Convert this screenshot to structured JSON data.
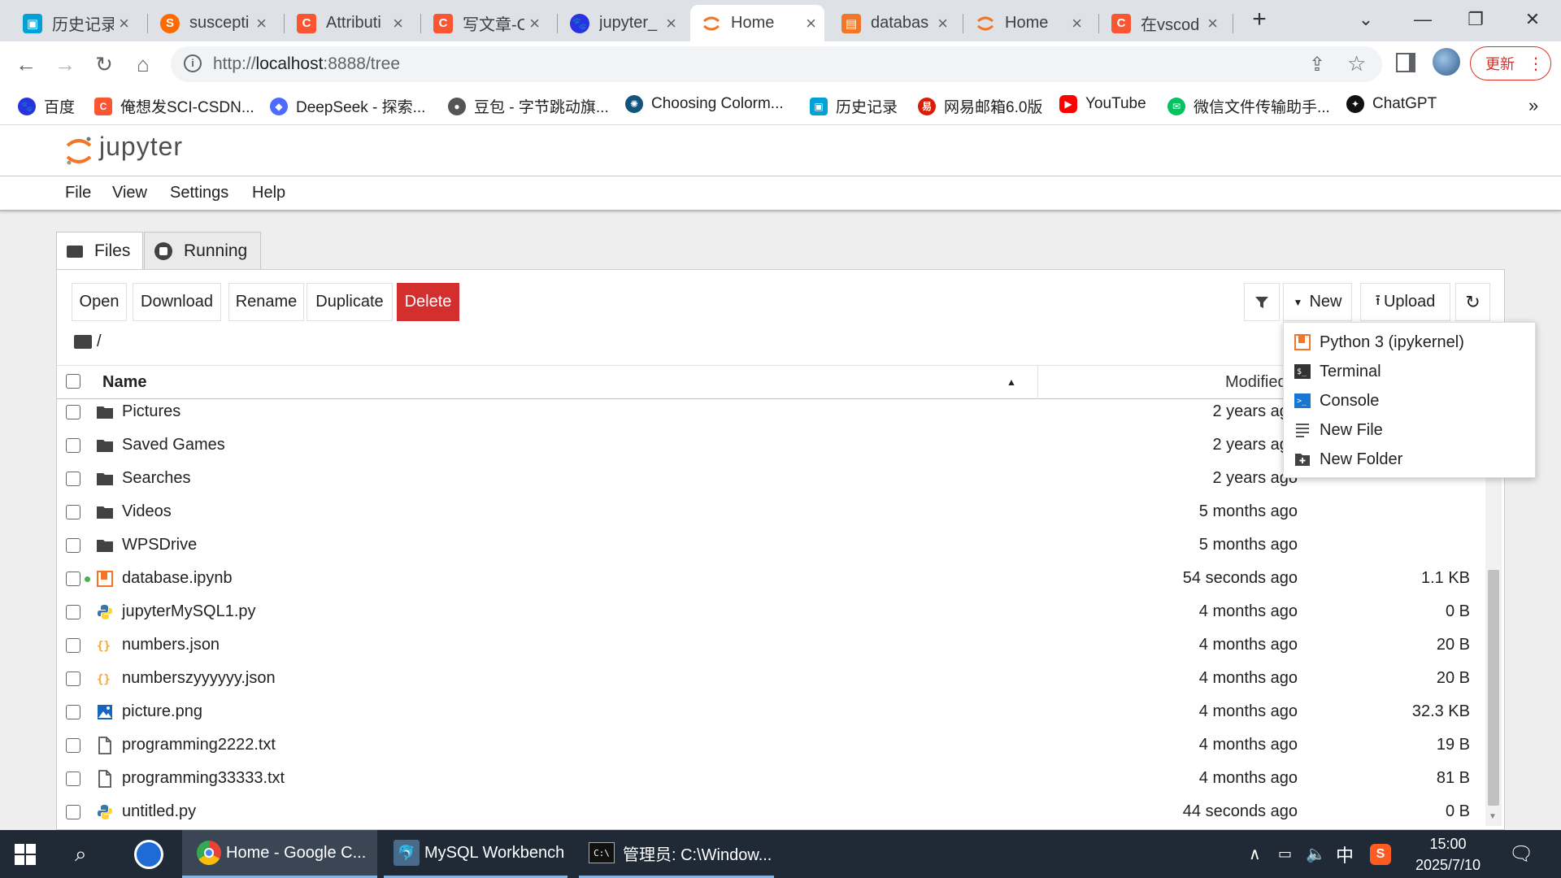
{
  "browser": {
    "tabs": [
      {
        "title": "历史记录",
        "icon": "bilibili-icon",
        "color": "#00a1d6"
      },
      {
        "title": "suscepti",
        "icon": "sougou-icon",
        "color": "#ff6a00"
      },
      {
        "title": "Attributi",
        "icon": "csdn-icon",
        "color": "#fc5531"
      },
      {
        "title": "写文章-C",
        "icon": "csdn-icon",
        "color": "#fc5531"
      },
      {
        "title": "jupyter_",
        "icon": "baidu-paw-icon",
        "color": "#2932e1"
      },
      {
        "title": "Home",
        "icon": "jupyter-icon",
        "color": "#f37626"
      },
      {
        "title": "databas",
        "icon": "notebook-icon",
        "color": "#f37626"
      },
      {
        "title": "Home",
        "icon": "jupyter-icon",
        "color": "#f37626"
      },
      {
        "title": "在vscod",
        "icon": "csdn-icon",
        "color": "#fc5531"
      }
    ],
    "active_tab": 5,
    "url_scheme": "http://",
    "url_host": "localhost",
    "url_rest": ":8888/tree",
    "update_label": "更新",
    "bookmarks": [
      {
        "label": "百度",
        "icon": "baidu-paw-icon",
        "color": "#2932e1"
      },
      {
        "label": "俺想发SCI-CSDN...",
        "icon": "csdn-icon",
        "color": "#fc5531"
      },
      {
        "label": "DeepSeek - 探索...",
        "icon": "deepseek-icon",
        "color": "#4d6bfe"
      },
      {
        "label": "豆包 - 字节跳动旗...",
        "icon": "doubao-icon",
        "color": "#666666"
      },
      {
        "label": "Choosing Colorm...",
        "icon": "matplotlib-icon",
        "color": "#11557c"
      },
      {
        "label": "历史记录",
        "icon": "bilibili-icon",
        "color": "#00a1d6"
      },
      {
        "label": "网易邮箱6.0版",
        "icon": "netease-icon",
        "color": "#d81e06"
      },
      {
        "label": "YouTube",
        "icon": "youtube-icon",
        "color": "#ff0000"
      },
      {
        "label": "微信文件传输助手...",
        "icon": "wechat-icon",
        "color": "#07c160"
      },
      {
        "label": "ChatGPT",
        "icon": "chatgpt-icon",
        "color": "#111111"
      }
    ]
  },
  "jupyter": {
    "logo_text": "jupyter",
    "menu": [
      "File",
      "View",
      "Settings",
      "Help"
    ],
    "tabs": [
      {
        "label": "Files"
      },
      {
        "label": "Running"
      }
    ],
    "actions": [
      "Open",
      "Download",
      "Rename",
      "Duplicate",
      "Delete"
    ],
    "new_label": "New",
    "upload_label": "Upload",
    "breadcrumb": "/",
    "columns": {
      "name": "Name",
      "modified": "Modified"
    },
    "files": [
      {
        "name": "Pictures",
        "type": "folder",
        "modified": "2 years ago",
        "size": ""
      },
      {
        "name": "Saved Games",
        "type": "folder",
        "modified": "2 years ago",
        "size": ""
      },
      {
        "name": "Searches",
        "type": "folder",
        "modified": "2 years ago",
        "size": ""
      },
      {
        "name": "Videos",
        "type": "folder",
        "modified": "5 months ago",
        "size": ""
      },
      {
        "name": "WPSDrive",
        "type": "folder",
        "modified": "5 months ago",
        "size": ""
      },
      {
        "name": "database.ipynb",
        "type": "notebook",
        "modified": "54 seconds ago",
        "size": "1.1 KB",
        "running": true
      },
      {
        "name": "jupyterMySQL1.py",
        "type": "python",
        "modified": "4 months ago",
        "size": "0 B"
      },
      {
        "name": "numbers.json",
        "type": "json",
        "modified": "4 months ago",
        "size": "20 B"
      },
      {
        "name": "numberszyyyyyy.json",
        "type": "json",
        "modified": "4 months ago",
        "size": "20 B"
      },
      {
        "name": "picture.png",
        "type": "image",
        "modified": "4 months ago",
        "size": "32.3 KB"
      },
      {
        "name": "programming2222.txt",
        "type": "text",
        "modified": "4 months ago",
        "size": "19 B"
      },
      {
        "name": "programming33333.txt",
        "type": "text",
        "modified": "4 months ago",
        "size": "81 B"
      },
      {
        "name": "untitled.py",
        "type": "python",
        "modified": "44 seconds ago",
        "size": "0 B"
      }
    ],
    "new_menu": [
      {
        "label": "Python 3 (ipykernel)",
        "icon": "notebook-icon"
      },
      {
        "label": "Terminal",
        "icon": "terminal-icon"
      },
      {
        "label": "Console",
        "icon": "console-icon"
      },
      {
        "label": "New File",
        "icon": "text-file-icon"
      },
      {
        "label": "New Folder",
        "icon": "new-folder-icon"
      }
    ]
  },
  "taskbar": {
    "apps": [
      {
        "label": "Home - Google C...",
        "icon": "chrome-icon"
      },
      {
        "label": "MySQL Workbench",
        "icon": "mysql-workbench-icon"
      },
      {
        "label": "管理员: C:\\Window...",
        "icon": "cmd-icon"
      }
    ],
    "ime": "中",
    "time": "15:00",
    "date": "2025/7/10"
  },
  "colors": {
    "accent": "#f37626",
    "delete": "#d32f2f",
    "folder": "#424242",
    "taskbar": "#1f2a36"
  }
}
